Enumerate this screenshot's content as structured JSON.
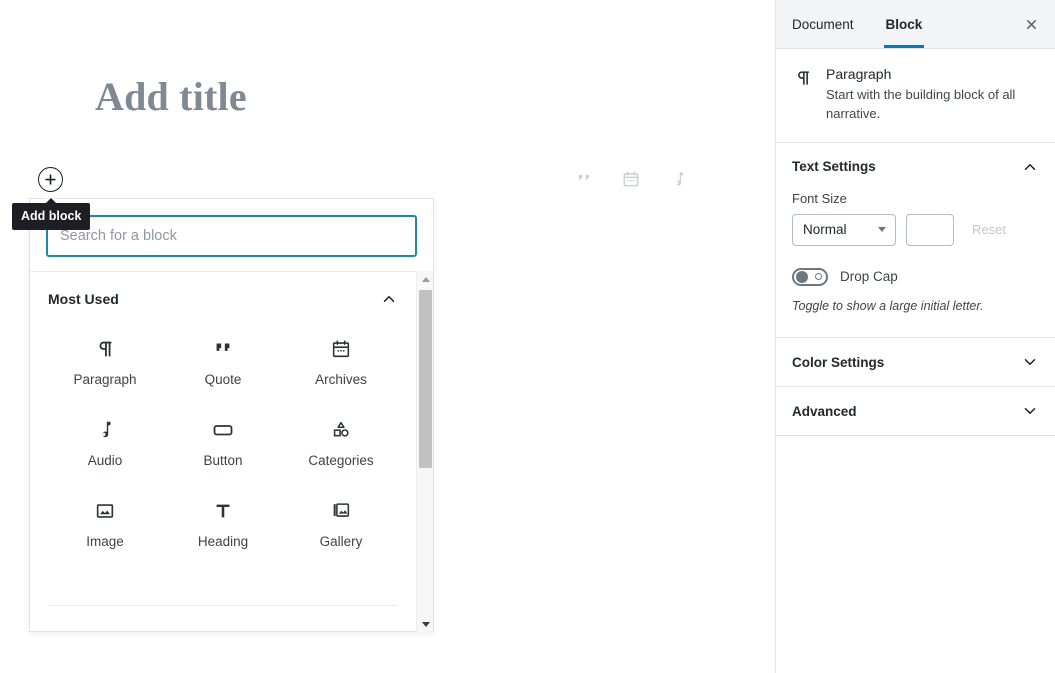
{
  "editor": {
    "title_placeholder": "Add title",
    "quick_inserts": [
      {
        "name": "quote-icon",
        "label": "Quote"
      },
      {
        "name": "archives-icon",
        "label": "Archives"
      },
      {
        "name": "audio-icon",
        "label": "Audio"
      }
    ]
  },
  "add_block": {
    "tooltip": "Add block",
    "icon": "plus-circle-icon"
  },
  "inserter": {
    "search_placeholder": "Search for a block",
    "search_value": "",
    "section_title": "Most Used",
    "section_expanded": true,
    "blocks": [
      {
        "label": "Paragraph",
        "icon": "paragraph-icon"
      },
      {
        "label": "Quote",
        "icon": "quote-icon"
      },
      {
        "label": "Archives",
        "icon": "archives-icon"
      },
      {
        "label": "Audio",
        "icon": "audio-icon"
      },
      {
        "label": "Button",
        "icon": "button-icon"
      },
      {
        "label": "Categories",
        "icon": "categories-icon"
      },
      {
        "label": "Image",
        "icon": "image-icon"
      },
      {
        "label": "Heading",
        "icon": "heading-icon"
      },
      {
        "label": "Gallery",
        "icon": "gallery-icon"
      }
    ]
  },
  "sidebar": {
    "tabs": [
      {
        "label": "Document",
        "active": false
      },
      {
        "label": "Block",
        "active": true
      }
    ],
    "close_icon": "close-icon",
    "block_card": {
      "icon": "paragraph-icon",
      "title": "Paragraph",
      "description": "Start with the building block of all narrative."
    },
    "panels": [
      {
        "title": "Text Settings",
        "expanded": true
      },
      {
        "title": "Color Settings",
        "expanded": false
      },
      {
        "title": "Advanced",
        "expanded": false
      }
    ],
    "text_settings": {
      "font_size_label": "Font Size",
      "font_size_value": "Normal",
      "font_size_number": "",
      "reset_label": "Reset",
      "drop_cap_label": "Drop Cap",
      "drop_cap_on": false,
      "drop_cap_help": "Toggle to show a large initial letter."
    }
  },
  "colors": {
    "accent_blue": "#007cba",
    "search_focus": "#1b8ba5",
    "title_gray": "#7e8993",
    "tooltip_bg": "#1e1e24"
  }
}
